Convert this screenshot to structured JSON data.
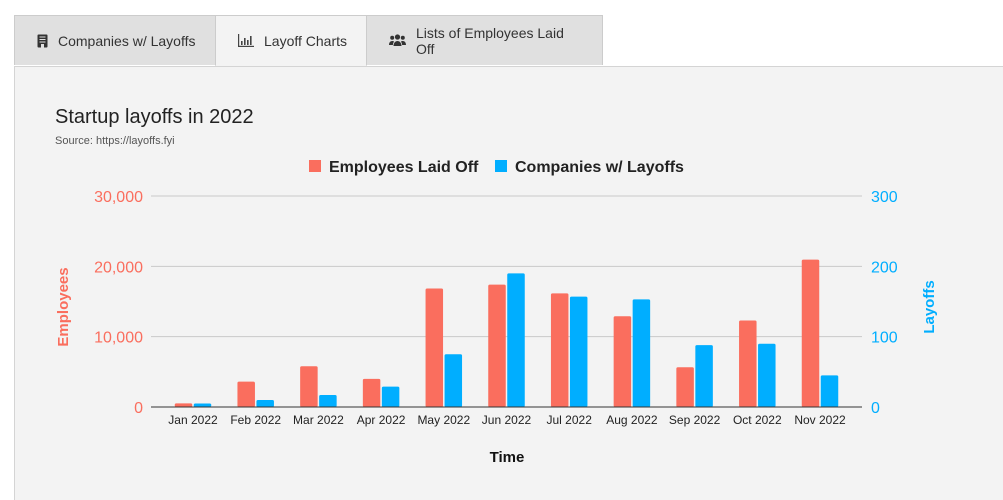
{
  "tabs": [
    {
      "label": "Companies w/ Layoffs",
      "icon": "building-icon",
      "active": false
    },
    {
      "label": "Layoff Charts",
      "icon": "bar-chart-icon",
      "active": true
    },
    {
      "label": "Lists of Employees Laid Off",
      "icon": "users-icon",
      "active": false
    }
  ],
  "colors": {
    "employees": "#fa6e5e",
    "companies": "#00aeff"
  },
  "chart_data": {
    "type": "bar",
    "title": "Startup layoffs in 2022",
    "subtitle": "Source: https://layoffs.fyi",
    "xlabel": "Time",
    "categories": [
      "Jan 2022",
      "Feb 2022",
      "Mar 2022",
      "Apr 2022",
      "May 2022",
      "Jun 2022",
      "Jul 2022",
      "Aug 2022",
      "Sep 2022",
      "Oct 2022",
      "Nov 2022"
    ],
    "series": [
      {
        "name": "Employees Laid Off",
        "axis": "left",
        "values": [
          510,
          3600,
          5800,
          4000,
          16850,
          17400,
          16150,
          12900,
          5650,
          12300,
          20950
        ]
      },
      {
        "name": "Companies w/ Layoffs",
        "axis": "right",
        "values": [
          5,
          10,
          17,
          29,
          75,
          190,
          157,
          153,
          88,
          90,
          45
        ]
      }
    ],
    "y_left": {
      "label": "Employees",
      "ylim": [
        0,
        30000
      ],
      "ticks": [
        "0",
        "10,000",
        "20,000",
        "30,000"
      ]
    },
    "y_right": {
      "label": "Layoffs",
      "ylim": [
        0,
        300
      ],
      "ticks": [
        "0",
        "100",
        "200",
        "300"
      ]
    },
    "legend": "top-center",
    "grid": true
  }
}
